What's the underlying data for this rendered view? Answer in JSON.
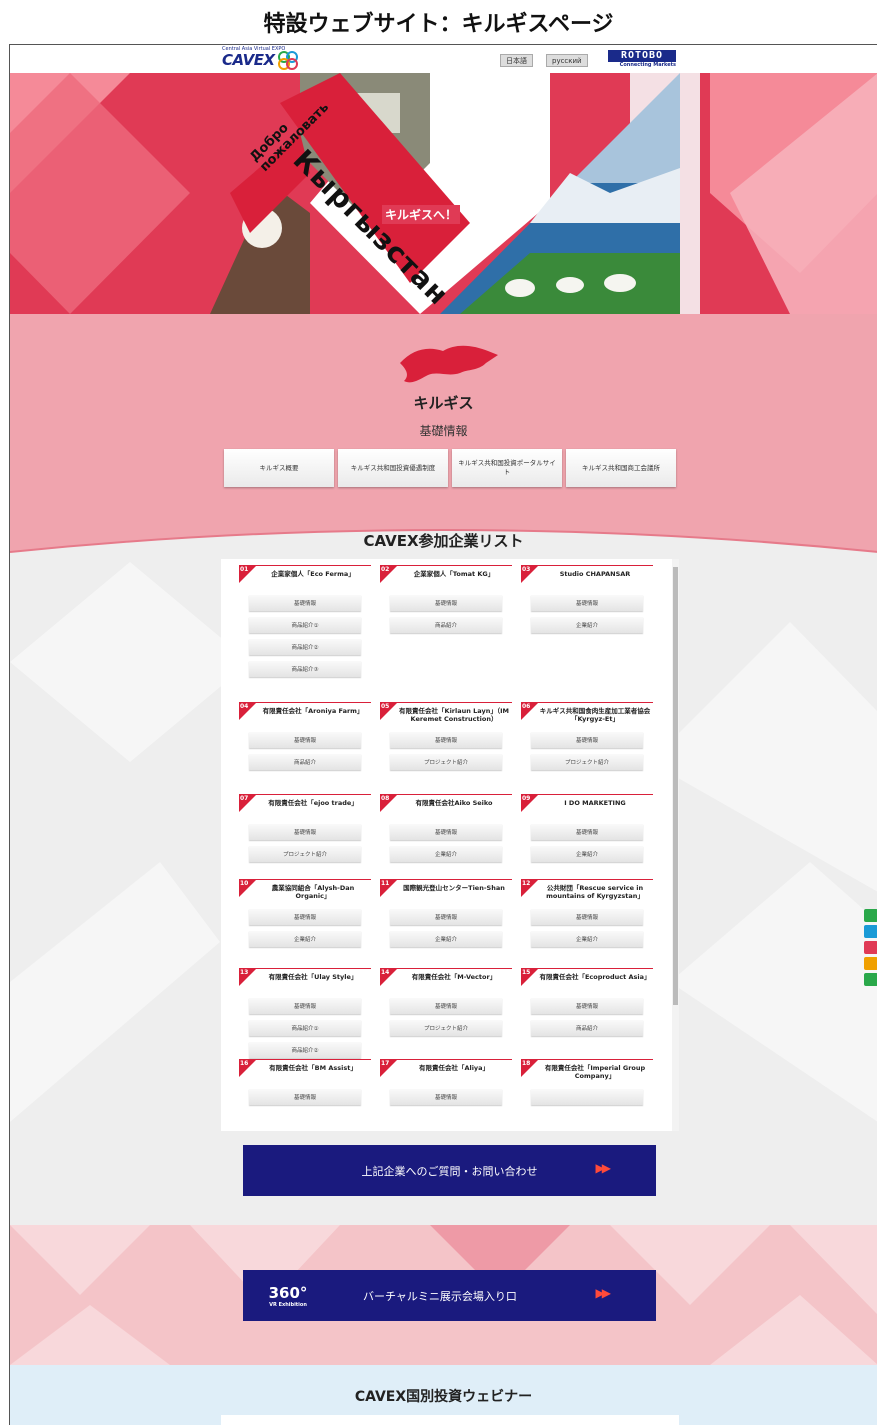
{
  "page_caption": "特設ウェブサイト：キルギスページ",
  "header": {
    "logo_text": "CAVEX",
    "logo_sub": "Central Asia Virtual EXPO",
    "lang_ja": "日本語",
    "lang_ru": "русский",
    "rotobo_main": "ROTOBO",
    "rotobo_sub": "Connecting Markets"
  },
  "hero": {
    "welcome_ru_1": "Добро",
    "welcome_ru_2": "пожаловать",
    "country_kg": "Кыргызстан",
    "welcome_ja": "キルギスへ！"
  },
  "country": {
    "title": "キルギス",
    "subtitle": "基礎情報",
    "buttons": [
      "キルギス概要",
      "キルギス共和国投資優遇制度",
      "キルギス共和国投資ポータルサイト",
      "キルギス共和国商工会議所"
    ]
  },
  "list_title": "CAVEX参加企業リスト",
  "companies": [
    {
      "num": "01",
      "name": "企業家個人「Eco Ferma」",
      "buttons": [
        "基礎情報",
        "商品紹介①",
        "商品紹介②",
        "商品紹介③"
      ]
    },
    {
      "num": "02",
      "name": "企業家個人「Tomat KG」",
      "buttons": [
        "基礎情報",
        "商品紹介"
      ]
    },
    {
      "num": "03",
      "name": "Studio CHAPANSAR",
      "buttons": [
        "基礎情報",
        "企業紹介"
      ]
    },
    {
      "num": "04",
      "name": "有限責任会社「Aroniya Farm」",
      "buttons": [
        "基礎情報",
        "商品紹介"
      ]
    },
    {
      "num": "05",
      "name": "有限責任会社「Kirlaun Layn」（IM Keremet Construction）",
      "buttons": [
        "基礎情報",
        "プロジェクト紹介"
      ]
    },
    {
      "num": "06",
      "name": "キルギス共和国食肉生産加工業者協会「Kyrgyz-Et」",
      "buttons": [
        "基礎情報",
        "プロジェクト紹介"
      ]
    },
    {
      "num": "07",
      "name": "有限責任会社「ejoo trade」",
      "buttons": [
        "基礎情報",
        "プロジェクト紹介"
      ]
    },
    {
      "num": "08",
      "name": "有限責任会社Aiko Seiko",
      "buttons": [
        "基礎情報",
        "企業紹介"
      ]
    },
    {
      "num": "09",
      "name": "I DO MARKETING",
      "buttons": [
        "基礎情報",
        "企業紹介"
      ]
    },
    {
      "num": "10",
      "name": "農業協同組合「Alysh-Dan Organic」",
      "buttons": [
        "基礎情報",
        "企業紹介"
      ]
    },
    {
      "num": "11",
      "name": "国際観光登山センターTien-Shan",
      "buttons": [
        "基礎情報",
        "企業紹介"
      ]
    },
    {
      "num": "12",
      "name": "公共財団「Rescue service in mountains of Kyrgyzstan」",
      "buttons": [
        "基礎情報",
        "企業紹介"
      ]
    },
    {
      "num": "13",
      "name": "有限責任会社「Ulay Style」",
      "buttons": [
        "基礎情報",
        "商品紹介①",
        "商品紹介②"
      ]
    },
    {
      "num": "14",
      "name": "有限責任会社「M-Vector」",
      "buttons": [
        "基礎情報",
        "プロジェクト紹介"
      ]
    },
    {
      "num": "15",
      "name": "有限責任会社「Ecoproduct Asia」",
      "buttons": [
        "基礎情報",
        "商品紹介"
      ]
    },
    {
      "num": "16",
      "name": "有限責任会社「BM Assist」",
      "buttons": [
        "基礎情報"
      ]
    },
    {
      "num": "17",
      "name": "有限責任会社「Aliya」",
      "buttons": [
        "基礎情報"
      ]
    },
    {
      "num": "18",
      "name": "有限責任会社「Imperial Group Company」",
      "buttons": [
        ""
      ]
    }
  ],
  "contact_label": "上記企業へのご質問・お問い合わせ",
  "arrow_glyph": "▶▶",
  "vr": {
    "logo_big": "360°",
    "logo_small": "VR Exhibition",
    "label": "バーチャルミニ展示会場入り口"
  },
  "webinar_title": "CAVEX国別投資ウェビナー",
  "side_icon_colors": [
    "#2aa84a",
    "#1a9ad6",
    "#e03a55",
    "#f0a000",
    "#2aa84a"
  ],
  "colors": {
    "accent_red": "#d9203a",
    "navy": "#1a1a7e",
    "pink": "#f0a4ae"
  }
}
